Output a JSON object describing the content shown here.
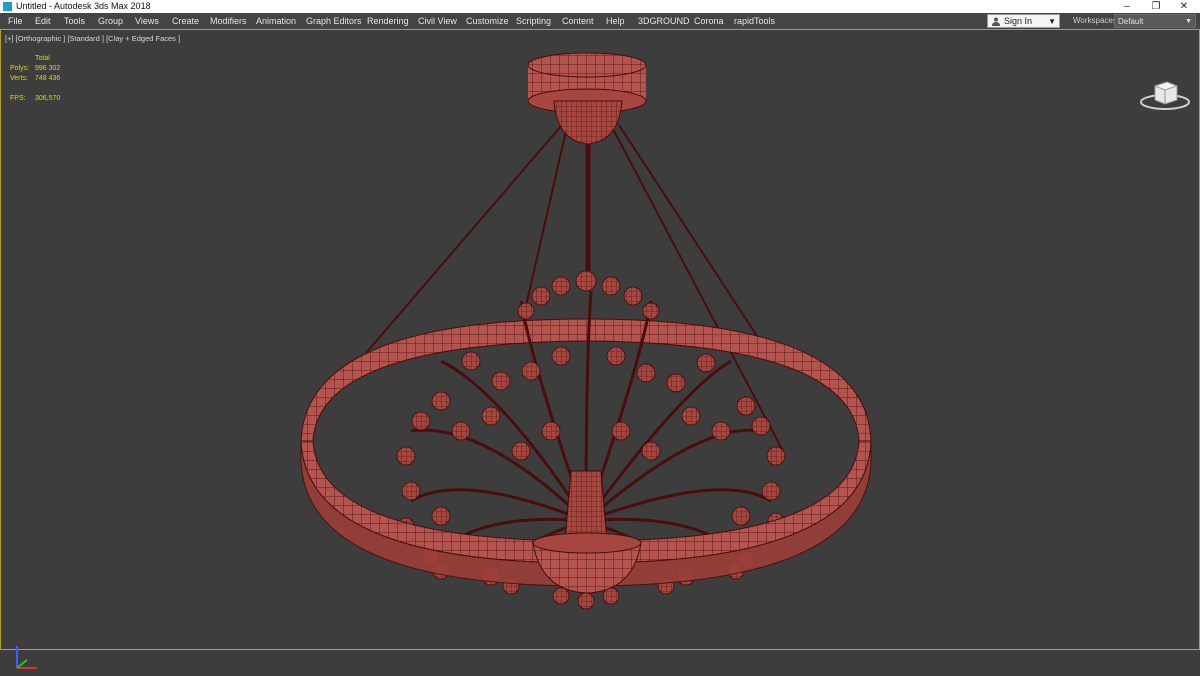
{
  "window": {
    "title": "Untitled - Autodesk 3ds Max 2018",
    "minimize": "–",
    "maximize": "❐",
    "close": "✕"
  },
  "menu": {
    "items": [
      "File",
      "Edit",
      "Tools",
      "Group",
      "Views",
      "Create",
      "Modifiers",
      "Animation",
      "Graph Editors",
      "Rendering",
      "Civil View",
      "Customize",
      "Scripting",
      "Content",
      "Help",
      "3DGROUND",
      "Corona",
      "rapidTools"
    ]
  },
  "account": {
    "sign_in": "Sign In"
  },
  "workspaces": {
    "label": "Workspaces:",
    "value": "Default"
  },
  "viewport": {
    "label": "[+] [Orthographic ] [Standard ] [Clay + Edged Faces ]",
    "stats": {
      "total_label": "Total",
      "polys_label": "Polys:",
      "polys_value": "996 302",
      "verts_label": "Verts:",
      "verts_value": "748 436",
      "fps_label": "FPS:",
      "fps_value": "306,570"
    }
  },
  "colors": {
    "viewport_bg": "#3d3d3d",
    "model": "#b3544f",
    "wire": "#4a0c0c",
    "stats_text": "#e6d400",
    "viewport_border": "#b3a12a"
  }
}
